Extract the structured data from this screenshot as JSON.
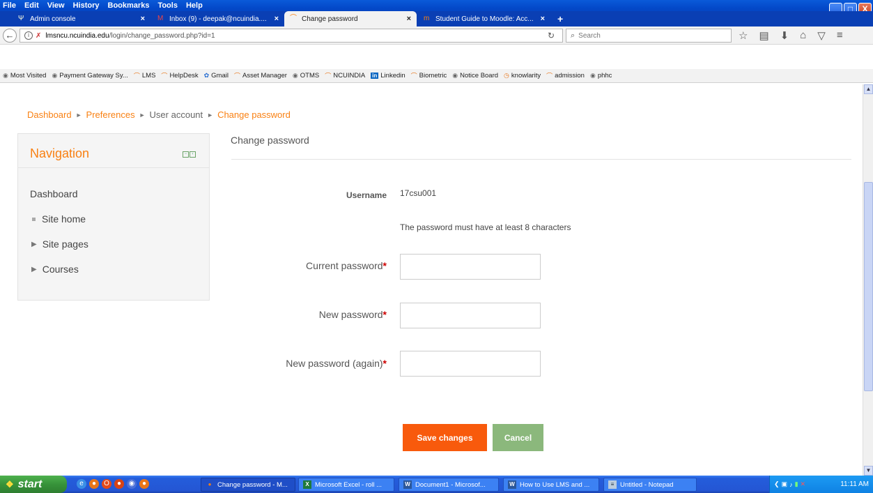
{
  "menu": [
    "File",
    "Edit",
    "View",
    "History",
    "Bookmarks",
    "Tools",
    "Help"
  ],
  "window_controls": {
    "minimize": "_",
    "maximize": "□",
    "close": "X"
  },
  "tabs": [
    {
      "label": "Admin console",
      "icon": "admin-icon",
      "close": "×"
    },
    {
      "label": "Inbox (9) - deepak@ncuindia....",
      "icon": "gmail-icon",
      "close": "×"
    },
    {
      "label": "Change password",
      "icon": "moodle-icon",
      "close": "×"
    },
    {
      "label": "Student Guide to Moodle: Acc...",
      "icon": "moodle-guide-icon",
      "close": "×"
    }
  ],
  "new_tab": "+",
  "address": {
    "host": "lmsncu.ncuindia.edu",
    "path": "/login/change_password.php?id=1"
  },
  "search": {
    "placeholder": "Search"
  },
  "bookmarks": [
    {
      "label": "Most Visited",
      "icon": "globe-icon"
    },
    {
      "label": "Payment Gateway Sy...",
      "icon": "globe-icon"
    },
    {
      "label": "LMS",
      "icon": "moodle-icon"
    },
    {
      "label": "HelpDesk",
      "icon": "moodle-icon"
    },
    {
      "label": "Gmail",
      "icon": "gmail-icon"
    },
    {
      "label": "Asset Manager",
      "icon": "moodle-icon"
    },
    {
      "label": "OTMS",
      "icon": "globe-icon"
    },
    {
      "label": "NCUINDIA",
      "icon": "moodle-icon"
    },
    {
      "label": "Linkedin",
      "icon": "linkedin-icon"
    },
    {
      "label": "Biometric",
      "icon": "moodle-icon"
    },
    {
      "label": "Notice Board",
      "icon": "globe-icon"
    },
    {
      "label": "knowlarity",
      "icon": "clock-icon"
    },
    {
      "label": "admission",
      "icon": "moodle-icon"
    },
    {
      "label": "phhc",
      "icon": "globe-icon"
    }
  ],
  "breadcrumb": {
    "items": [
      "Dashboard",
      "Preferences",
      "User account",
      "Change password"
    ],
    "sep": "►"
  },
  "navigation": {
    "title": "Navigation",
    "dashboard": "Dashboard",
    "items": [
      "Site home",
      "Site pages",
      "Courses"
    ]
  },
  "form": {
    "title": "Change password",
    "username_label": "Username",
    "username_value": "17csu001",
    "rule": "The password must have at least 8 characters",
    "current_label": "Current password",
    "new_label": "New password",
    "again_label": "New password (again)",
    "required_mark": "*",
    "save": "Save changes",
    "cancel": "Cancel"
  },
  "taskbar": {
    "start": "start",
    "tasks": [
      {
        "label": "Change password - M...",
        "icon": "firefox-icon"
      },
      {
        "label": "Microsoft Excel - roll ...",
        "icon": "excel-icon"
      },
      {
        "label": "Document1 - Microsof...",
        "icon": "word-icon"
      },
      {
        "label": "How to Use LMS and ...",
        "icon": "word-icon"
      },
      {
        "label": "Untitled - Notepad",
        "icon": "notepad-icon"
      }
    ],
    "clock": "11:11 AM"
  },
  "colors": {
    "accent": "#f98012",
    "save_button": "#f85a0c",
    "cancel_button": "#8bb87c",
    "required": "#c00000"
  }
}
